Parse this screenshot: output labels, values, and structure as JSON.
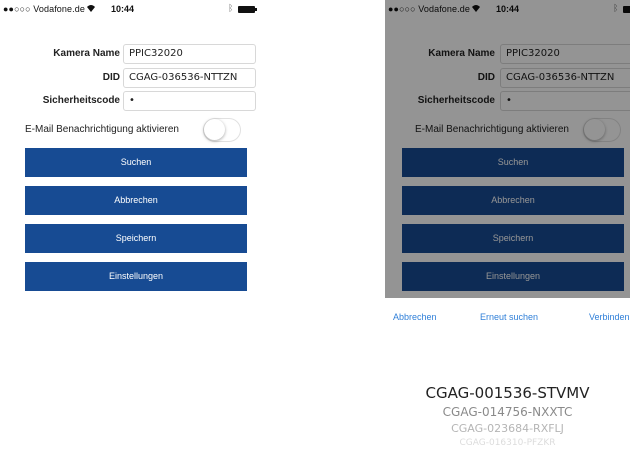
{
  "status_bar": {
    "carrier": "●●○○○ Vodafone.de",
    "wifi": "wifi-icon",
    "time": "10:44",
    "bluetooth": "bluetooth-icon",
    "battery": "battery-icon"
  },
  "form": {
    "camera_name_label": "Kamera Name",
    "camera_name_value": "PPIC32020",
    "did_label": "DID",
    "did_value": "CGAG-036536-NTTZN",
    "security_label": "Sicherheitscode",
    "security_value": "•",
    "email_toggle_label": "E-Mail Benachrichtigung aktivieren",
    "email_toggle_on": false
  },
  "buttons": {
    "search": "Suchen",
    "cancel": "Abbrechen",
    "save": "Speichern",
    "settings": "Einstellungen"
  },
  "action_sheet": {
    "cancel": "Abbrechen",
    "retry_search": "Erneut suchen",
    "connect": "Verbinden"
  },
  "picker": {
    "items": [
      "CGAG-001536-STVMV",
      "CGAG-014756-NXXTC",
      "CGAG-023684-RXFLJ",
      "CGAG-016310-PFZKR"
    ]
  },
  "colors": {
    "button_blue": "#174b93",
    "link_blue": "#2f7fd8"
  }
}
